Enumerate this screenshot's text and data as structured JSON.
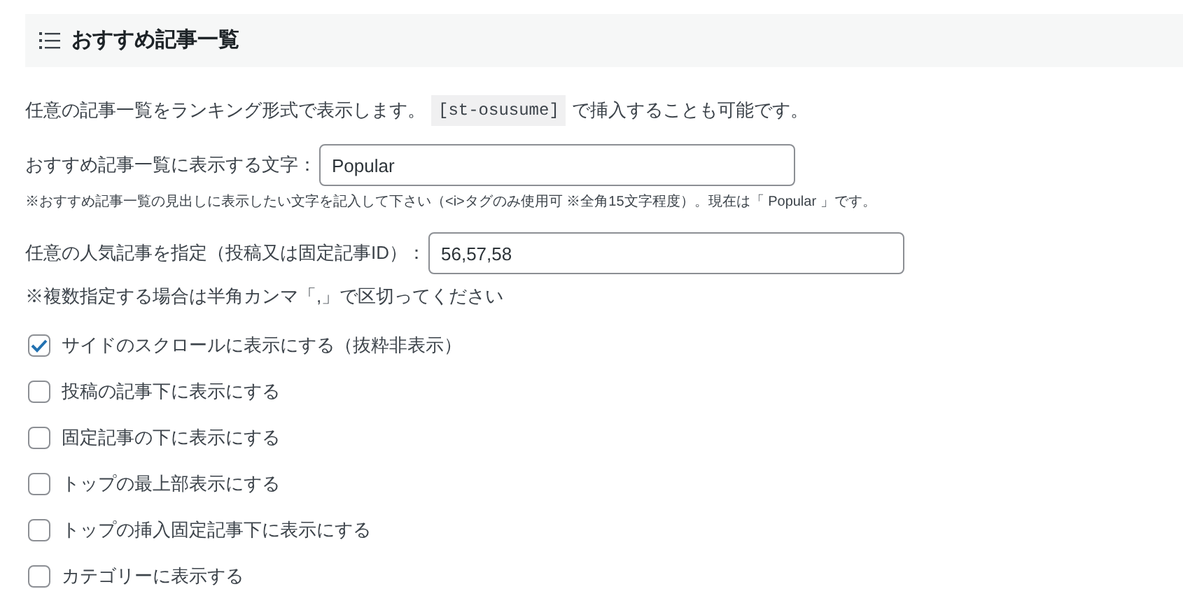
{
  "section": {
    "title": "おすすめ記事一覧"
  },
  "intro": {
    "before": "任意の記事一覧をランキング形式で表示します。",
    "code": "[st-osusume]",
    "after": "で挿入することも可能です。"
  },
  "fields": [
    {
      "label": "おすすめ記事一覧に表示する文字：",
      "value": "Popular",
      "note": "※おすすめ記事一覧の見出しに表示したい文字を記入して下さい（<i>タグのみ使用可 ※全角15文字程度）。現在は「 Popular 」です。",
      "kind": "hint"
    },
    {
      "label": "任意の人気記事を指定（投稿又は固定記事ID）：",
      "value": "56,57,58",
      "note": "※複数指定する場合は半角カンマ「,」で区切ってください",
      "kind": "notice"
    }
  ],
  "options": [
    {
      "label": "サイドのスクロールに表示にする（抜粋非表示）",
      "checked": true
    },
    {
      "label": "投稿の記事下に表示にする",
      "checked": false
    },
    {
      "label": "固定記事の下に表示にする",
      "checked": false
    },
    {
      "label": "トップの最上部表示にする",
      "checked": false
    },
    {
      "label": "トップの挿入固定記事下に表示にする",
      "checked": false
    },
    {
      "label": "カテゴリーに表示する",
      "checked": false
    }
  ]
}
